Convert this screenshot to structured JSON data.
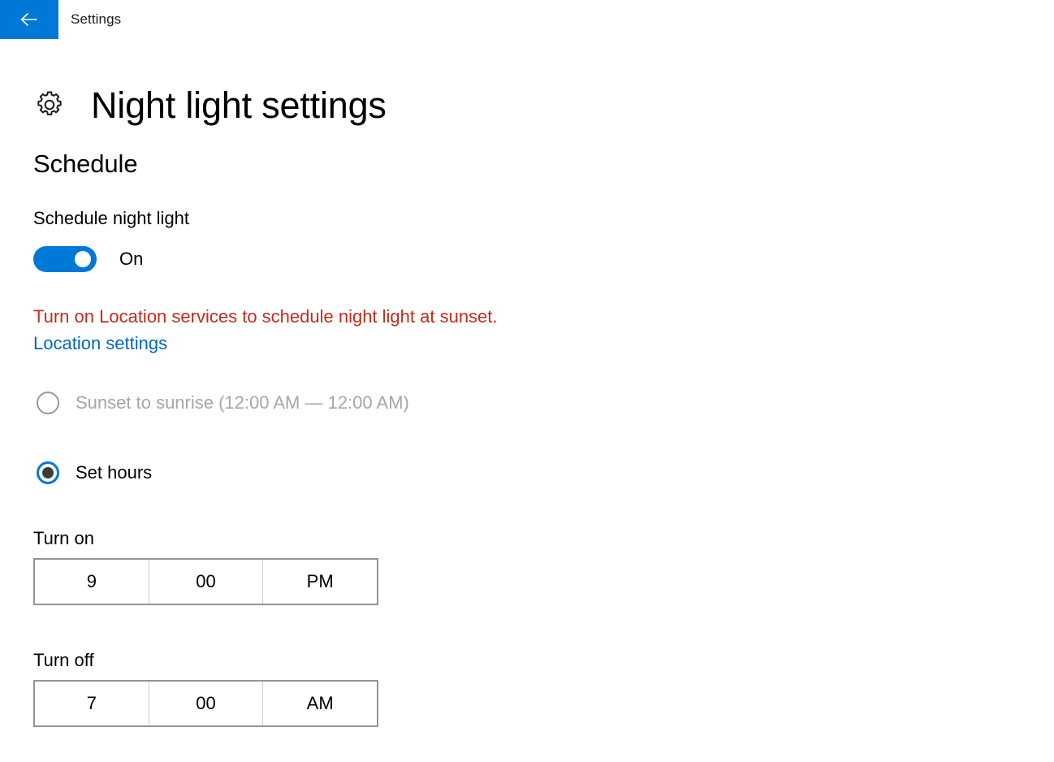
{
  "titlebar": {
    "back_icon": "back-arrow-icon",
    "app_title": "Settings",
    "accent_color": "#0078d7"
  },
  "page": {
    "icon": "gear-icon",
    "title": "Night light settings",
    "section_heading": "Schedule"
  },
  "schedule": {
    "toggle_label": "Schedule night light",
    "toggle_state": "On",
    "toggle_on": true,
    "warning_text": "Turn on Location services to schedule night light at sunset.",
    "warning_color": "#c42b1c",
    "link_text": "Location settings",
    "link_color": "#0067c0",
    "options": [
      {
        "label": "Sunset to sunrise (12:00 AM — 12:00 AM)",
        "selected": false,
        "disabled": true,
        "name": "radio-sunset-to-sunrise"
      },
      {
        "label": "Set hours",
        "selected": true,
        "disabled": false,
        "name": "radio-set-hours"
      }
    ]
  },
  "turn_on": {
    "label": "Turn on",
    "hour": "9",
    "minute": "00",
    "period": "PM"
  },
  "turn_off": {
    "label": "Turn off",
    "hour": "7",
    "minute": "00",
    "period": "AM"
  }
}
